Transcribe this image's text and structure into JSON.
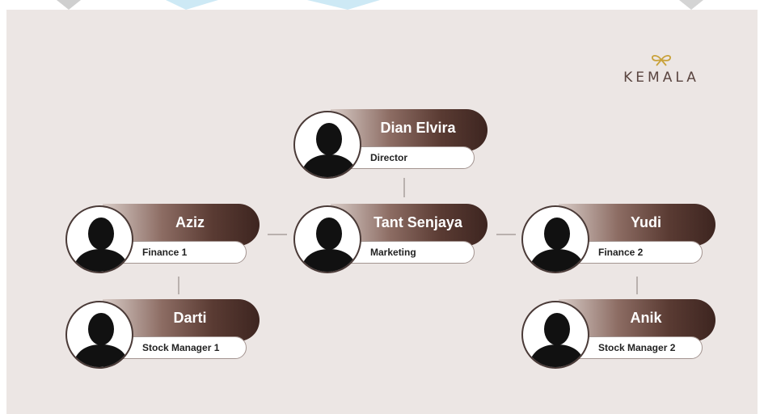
{
  "brand": {
    "name": "KEMALA",
    "accent": "#c9a23a"
  },
  "colors": {
    "background": "#ece6e4",
    "gradient_dark": "#3d2520",
    "connector": "#b9b1ae"
  },
  "people": {
    "director": {
      "name": "Dian Elvira",
      "role": "Director"
    },
    "marketing": {
      "name": "Tant Senjaya",
      "role": "Marketing"
    },
    "finance1": {
      "name": "Aziz",
      "role": "Finance 1"
    },
    "finance2": {
      "name": "Yudi",
      "role": "Finance 2"
    },
    "stock1": {
      "name": "Darti",
      "role": "Stock Manager 1"
    },
    "stock2": {
      "name": "Anik",
      "role": "Stock Manager 2"
    }
  }
}
